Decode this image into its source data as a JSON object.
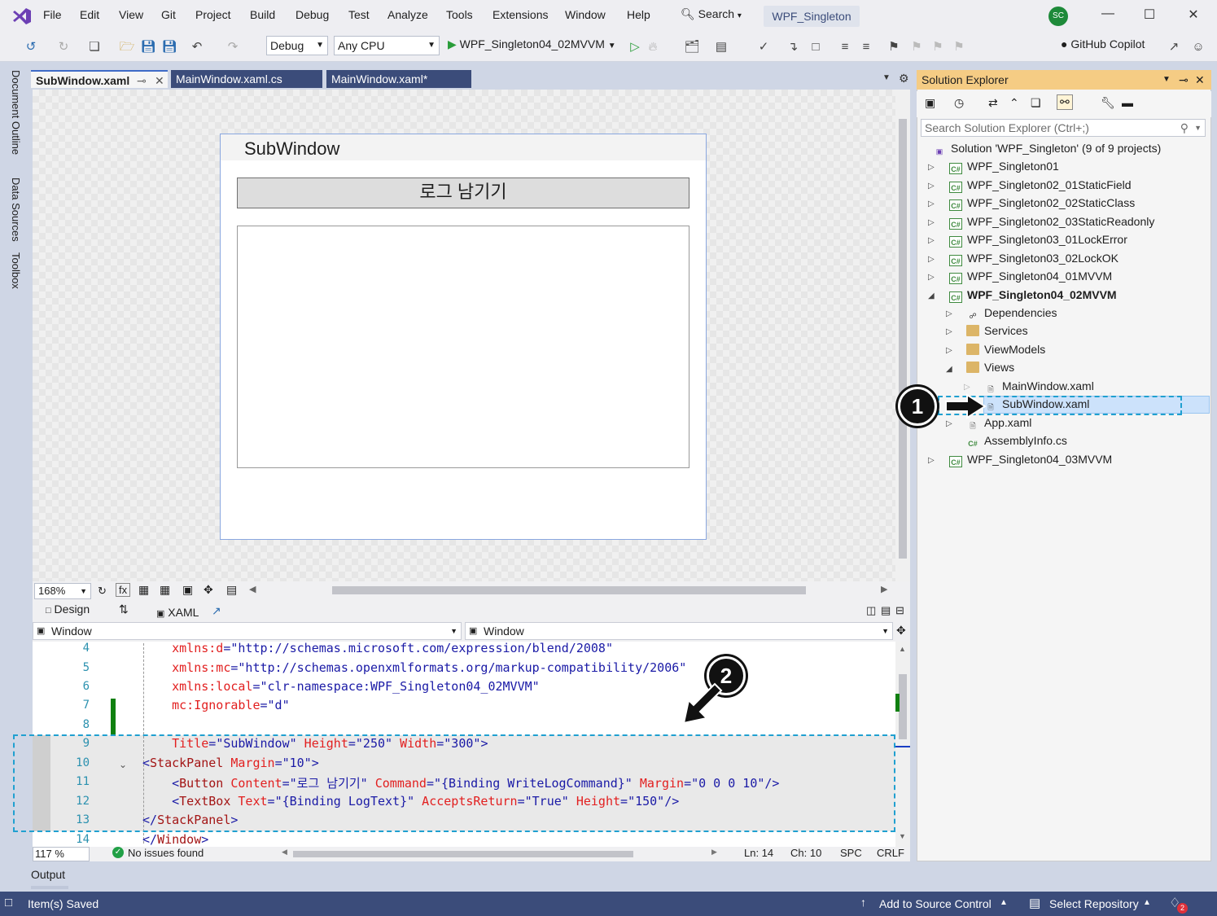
{
  "menubar": {
    "items": [
      "File",
      "Edit",
      "View",
      "Git",
      "Project",
      "Build",
      "Debug",
      "Test",
      "Analyze",
      "Tools",
      "Extensions",
      "Window",
      "Help"
    ],
    "search_label": "Search",
    "solution_name": "WPF_Singleton",
    "avatar_initials": "SC"
  },
  "toolbar": {
    "config": "Debug",
    "platform": "Any CPU",
    "startup_project": "WPF_Singleton04_02MVVM",
    "copilot_label": "GitHub Copilot"
  },
  "left_rail": [
    "Document Outline",
    "Data Sources",
    "Toolbox"
  ],
  "tabs": [
    {
      "label": "SubWindow.xaml",
      "active": true
    },
    {
      "label": "MainWindow.xaml.cs",
      "active": false
    },
    {
      "label": "MainWindow.xaml*",
      "active": false
    }
  ],
  "designer": {
    "window_title": "SubWindow",
    "button_label": "로그 남기기",
    "zoom": "168%",
    "design_tab": "Design",
    "xaml_tab": "XAML"
  },
  "nav": {
    "left_combo": "Window",
    "right_combo": "Window"
  },
  "code_lines": [
    {
      "n": "4",
      "parts": [
        [
          "att",
          "    xmlns:d"
        ],
        [
          "pn",
          "="
        ],
        [
          "val",
          "\"http://schemas.microsoft.com/expression/blend/2008\""
        ]
      ]
    },
    {
      "n": "5",
      "parts": [
        [
          "att",
          "    xmlns:mc"
        ],
        [
          "pn",
          "="
        ],
        [
          "val",
          "\"http://schemas.openxmlformats.org/markup-compatibility/2006\""
        ]
      ]
    },
    {
      "n": "6",
      "parts": [
        [
          "att",
          "    xmlns:local"
        ],
        [
          "pn",
          "="
        ],
        [
          "val",
          "\"clr-namespace:WPF_Singleton04_02MVVM\""
        ]
      ]
    },
    {
      "n": "7",
      "parts": [
        [
          "att",
          "    mc:Ignorable"
        ],
        [
          "pn",
          "="
        ],
        [
          "val",
          "\"d\""
        ]
      ]
    },
    {
      "n": "8",
      "parts": []
    },
    {
      "n": "9",
      "parts": [
        [
          "att",
          "    Title"
        ],
        [
          "pn",
          "="
        ],
        [
          "val",
          "\"SubWindow\""
        ],
        [
          "att",
          " Height"
        ],
        [
          "pn",
          "="
        ],
        [
          "val",
          "\"250\""
        ],
        [
          "att",
          " Width"
        ],
        [
          "pn",
          "="
        ],
        [
          "val",
          "\"300\""
        ],
        [
          "pn",
          ">"
        ]
      ]
    },
    {
      "n": "10",
      "parts": [
        [
          "pn",
          "<"
        ],
        [
          "tag",
          "StackPanel"
        ],
        [
          "att",
          " Margin"
        ],
        [
          "pn",
          "="
        ],
        [
          "val",
          "\"10\""
        ],
        [
          "pn",
          ">"
        ]
      ]
    },
    {
      "n": "11",
      "parts": [
        [
          "pn",
          "    <"
        ],
        [
          "tag",
          "Button"
        ],
        [
          "att",
          " Content"
        ],
        [
          "pn",
          "="
        ],
        [
          "val",
          "\"로그 남기기\""
        ],
        [
          "att",
          " Command"
        ],
        [
          "pn",
          "="
        ],
        [
          "val",
          "\"{Binding WriteLogCommand}\""
        ],
        [
          "att",
          " Margin"
        ],
        [
          "pn",
          "="
        ],
        [
          "val",
          "\"0 0 0 10\""
        ],
        [
          "pn",
          "/>"
        ]
      ]
    },
    {
      "n": "12",
      "parts": [
        [
          "pn",
          "    <"
        ],
        [
          "tag",
          "TextBox"
        ],
        [
          "att",
          " Text"
        ],
        [
          "pn",
          "="
        ],
        [
          "val",
          "\"{Binding LogText}\""
        ],
        [
          "att",
          " AcceptsReturn"
        ],
        [
          "pn",
          "="
        ],
        [
          "val",
          "\"True\""
        ],
        [
          "att",
          " Height"
        ],
        [
          "pn",
          "="
        ],
        [
          "val",
          "\"150\""
        ],
        [
          "pn",
          "/>"
        ]
      ]
    },
    {
      "n": "13",
      "parts": [
        [
          "pn",
          "</"
        ],
        [
          "tag",
          "StackPanel"
        ],
        [
          "pn",
          ">"
        ]
      ]
    },
    {
      "n": "14",
      "parts": [
        [
          "pn",
          "</"
        ],
        [
          "tag",
          "Window"
        ],
        [
          "pn",
          ">"
        ]
      ]
    }
  ],
  "editor_status": {
    "zoom": "117 %",
    "issues": "No issues found",
    "line": "Ln: 14",
    "col": "Ch: 10",
    "spc": "SPC",
    "crlf": "CRLF"
  },
  "output_label": "Output",
  "statusbar": {
    "message": "Item(s) Saved",
    "source_control": "Add to Source Control",
    "repo": "Select Repository",
    "notif_count": "2"
  },
  "solution_explorer": {
    "title": "Solution Explorer",
    "search_placeholder": "Search Solution Explorer (Ctrl+;)",
    "solution": "Solution 'WPF_Singleton' (9 of 9 projects)",
    "projects": [
      "WPF_Singleton01",
      "WPF_Singleton02_01StaticField",
      "WPF_Singleton02_02StaticClass",
      "WPF_Singleton02_03StaticReadonly",
      "WPF_Singleton03_01LockError",
      "WPF_Singleton03_02LockOK",
      "WPF_Singleton04_01MVVM"
    ],
    "expanded_project": "WPF_Singleton04_02MVVM",
    "children": [
      "Dependencies",
      "Services",
      "ViewModels",
      "Views"
    ],
    "views_children": [
      "MainWindow.xaml",
      "SubWindow.xaml"
    ],
    "after_views": [
      "App.xaml",
      "AssemblyInfo.cs"
    ],
    "last_project": "WPF_Singleton04_03MVVM"
  },
  "callouts": [
    "1",
    "2"
  ]
}
